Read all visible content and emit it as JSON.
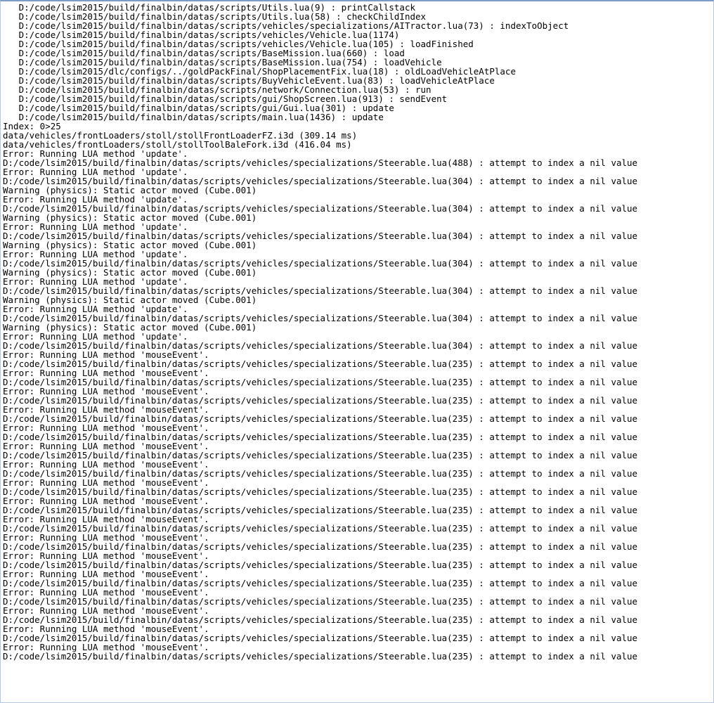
{
  "log": {
    "lines": [
      "   D:/code/lsim2015/build/finalbin/datas/scripts/Utils.lua(9) : printCallstack",
      "   D:/code/lsim2015/build/finalbin/datas/scripts/Utils.lua(58) : checkChildIndex",
      "   D:/code/lsim2015/build/finalbin/datas/scripts/vehicles/specializations/AITractor.lua(73) : indexToObject",
      "   D:/code/lsim2015/build/finalbin/datas/scripts/vehicles/Vehicle.lua(1174)",
      "   D:/code/lsim2015/build/finalbin/datas/scripts/vehicles/Vehicle.lua(105) : loadFinished",
      "   D:/code/lsim2015/build/finalbin/datas/scripts/BaseMission.lua(660) : load",
      "   D:/code/lsim2015/build/finalbin/datas/scripts/BaseMission.lua(754) : loadVehicle",
      "   D:/code/lsim2015/dlc/configs/../goldPackFinal/ShopPlacementFix.lua(18) : oldLoadVehicleAtPlace",
      "   D:/code/lsim2015/build/finalbin/datas/scripts/BuyVehicleEvent.lua(83) : loadVehicleAtPlace",
      "   D:/code/lsim2015/build/finalbin/datas/scripts/network/Connection.lua(53) : run",
      "   D:/code/lsim2015/build/finalbin/datas/scripts/gui/ShopScreen.lua(913) : sendEvent",
      "   D:/code/lsim2015/build/finalbin/datas/scripts/gui/Gui.lua(301) : update",
      "   D:/code/lsim2015/build/finalbin/datas/scripts/main.lua(1436) : update",
      "Index: 0>25",
      "data/vehicles/frontLoaders/stoll/stollFrontLoaderFZ.i3d (309.14 ms)",
      "data/vehicles/frontLoaders/stoll/stollToolBaleFork.i3d (416.04 ms)",
      "Error: Running LUA method 'update'.",
      "D:/code/lsim2015/build/finalbin/datas/scripts/vehicles/specializations/Steerable.lua(488) : attempt to index a nil value",
      "Error: Running LUA method 'update'.",
      "D:/code/lsim2015/build/finalbin/datas/scripts/vehicles/specializations/Steerable.lua(304) : attempt to index a nil value",
      "Warning (physics): Static actor moved (Cube.001)",
      "Error: Running LUA method 'update'.",
      "D:/code/lsim2015/build/finalbin/datas/scripts/vehicles/specializations/Steerable.lua(304) : attempt to index a nil value",
      "Warning (physics): Static actor moved (Cube.001)",
      "Error: Running LUA method 'update'.",
      "D:/code/lsim2015/build/finalbin/datas/scripts/vehicles/specializations/Steerable.lua(304) : attempt to index a nil value",
      "Warning (physics): Static actor moved (Cube.001)",
      "Error: Running LUA method 'update'.",
      "D:/code/lsim2015/build/finalbin/datas/scripts/vehicles/specializations/Steerable.lua(304) : attempt to index a nil value",
      "Warning (physics): Static actor moved (Cube.001)",
      "Error: Running LUA method 'update'.",
      "D:/code/lsim2015/build/finalbin/datas/scripts/vehicles/specializations/Steerable.lua(304) : attempt to index a nil value",
      "Warning (physics): Static actor moved (Cube.001)",
      "Error: Running LUA method 'update'.",
      "D:/code/lsim2015/build/finalbin/datas/scripts/vehicles/specializations/Steerable.lua(304) : attempt to index a nil value",
      "Warning (physics): Static actor moved (Cube.001)",
      "Error: Running LUA method 'update'.",
      "D:/code/lsim2015/build/finalbin/datas/scripts/vehicles/specializations/Steerable.lua(304) : attempt to index a nil value",
      "Error: Running LUA method 'mouseEvent'.",
      "D:/code/lsim2015/build/finalbin/datas/scripts/vehicles/specializations/Steerable.lua(235) : attempt to index a nil value",
      "Error: Running LUA method 'mouseEvent'.",
      "D:/code/lsim2015/build/finalbin/datas/scripts/vehicles/specializations/Steerable.lua(235) : attempt to index a nil value",
      "Error: Running LUA method 'mouseEvent'.",
      "D:/code/lsim2015/build/finalbin/datas/scripts/vehicles/specializations/Steerable.lua(235) : attempt to index a nil value",
      "Error: Running LUA method 'mouseEvent'.",
      "D:/code/lsim2015/build/finalbin/datas/scripts/vehicles/specializations/Steerable.lua(235) : attempt to index a nil value",
      "Error: Running LUA method 'mouseEvent'.",
      "D:/code/lsim2015/build/finalbin/datas/scripts/vehicles/specializations/Steerable.lua(235) : attempt to index a nil value",
      "Error: Running LUA method 'mouseEvent'.",
      "D:/code/lsim2015/build/finalbin/datas/scripts/vehicles/specializations/Steerable.lua(235) : attempt to index a nil value",
      "Error: Running LUA method 'mouseEvent'.",
      "D:/code/lsim2015/build/finalbin/datas/scripts/vehicles/specializations/Steerable.lua(235) : attempt to index a nil value",
      "Error: Running LUA method 'mouseEvent'.",
      "D:/code/lsim2015/build/finalbin/datas/scripts/vehicles/specializations/Steerable.lua(235) : attempt to index a nil value",
      "Error: Running LUA method 'mouseEvent'.",
      "D:/code/lsim2015/build/finalbin/datas/scripts/vehicles/specializations/Steerable.lua(235) : attempt to index a nil value",
      "Error: Running LUA method 'mouseEvent'.",
      "D:/code/lsim2015/build/finalbin/datas/scripts/vehicles/specializations/Steerable.lua(235) : attempt to index a nil value",
      "Error: Running LUA method 'mouseEvent'.",
      "D:/code/lsim2015/build/finalbin/datas/scripts/vehicles/specializations/Steerable.lua(235) : attempt to index a nil value",
      "Error: Running LUA method 'mouseEvent'.",
      "D:/code/lsim2015/build/finalbin/datas/scripts/vehicles/specializations/Steerable.lua(235) : attempt to index a nil value",
      "Error: Running LUA method 'mouseEvent'.",
      "D:/code/lsim2015/build/finalbin/datas/scripts/vehicles/specializations/Steerable.lua(235) : attempt to index a nil value",
      "Error: Running LUA method 'mouseEvent'.",
      "D:/code/lsim2015/build/finalbin/datas/scripts/vehicles/specializations/Steerable.lua(235) : attempt to index a nil value",
      "Error: Running LUA method 'mouseEvent'.",
      "D:/code/lsim2015/build/finalbin/datas/scripts/vehicles/specializations/Steerable.lua(235) : attempt to index a nil value",
      "Error: Running LUA method 'mouseEvent'.",
      "D:/code/lsim2015/build/finalbin/datas/scripts/vehicles/specializations/Steerable.lua(235) : attempt to index a nil value",
      "Error: Running LUA method 'mouseEvent'.",
      "D:/code/lsim2015/build/finalbin/datas/scripts/vehicles/specializations/Steerable.lua(235) : attempt to index a nil value"
    ]
  }
}
